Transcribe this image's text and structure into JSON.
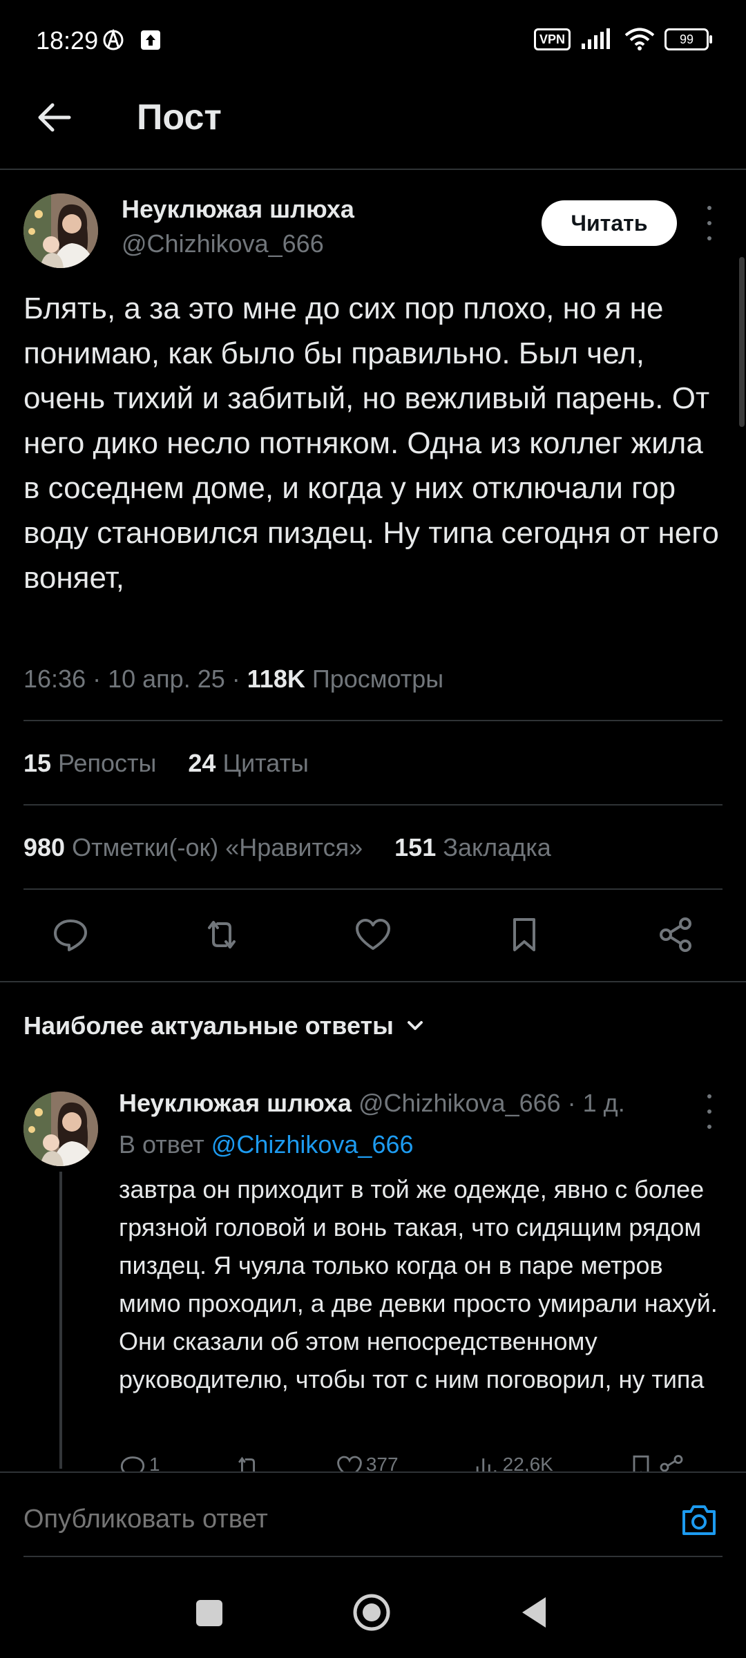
{
  "status_bar": {
    "time": "18:29",
    "vpn": "VPN",
    "battery": "99"
  },
  "header": {
    "title": "Пост"
  },
  "post": {
    "author_name": "Неуклюжая шлюха",
    "author_handle": "@Chizhikova_666",
    "follow_label": "Читать",
    "text": "Блять, а за это мне до сих пор плохо, но я не понимаю, как было бы правильно. Был чел, очень тихий и забитый, но вежливый парень. От него дико несло потняком. Одна из коллег жила в соседнем доме, и когда у них отключали гор воду становился пиздец. Ну типа сегодня от него воняет,",
    "time": "16:36",
    "date": "10 апр. 25",
    "views_count": "118K",
    "views_label": "Просмотры",
    "reposts_count": "15",
    "reposts_label": "Репосты",
    "quotes_count": "24",
    "quotes_label": "Цитаты",
    "likes_count": "980",
    "likes_label": "Отметки(-ок) «Нравится»",
    "bookmarks_count": "151",
    "bookmarks_label": "Закладка"
  },
  "replies": {
    "sort_label": "Наиболее актуальные ответы",
    "items": [
      {
        "author_name": "Неуклюжая шлюха",
        "author_handle": "@Chizhikova_666",
        "age": "· 1 д.",
        "reply_to_prefix": "В ответ",
        "reply_to_handle": "@Chizhikova_666",
        "text": "завтра он приходит в той же одежде, явно с более грязной головой и вонь такая, что сидящим рядом пиздец. Я чуяла только когда он в паре метров мимо проходил, а две девки просто умирали нахуй. Они сказали об этом непосредственному руководителю, чтобы тот с ним поговорил, ну типа",
        "replies_count": "1",
        "likes_count": "377",
        "views_count": "22,6K"
      }
    ]
  },
  "compose": {
    "placeholder": "Опубликовать ответ"
  },
  "colors": {
    "accent": "#1d9bf0",
    "background": "#000000",
    "muted": "#71767b"
  }
}
